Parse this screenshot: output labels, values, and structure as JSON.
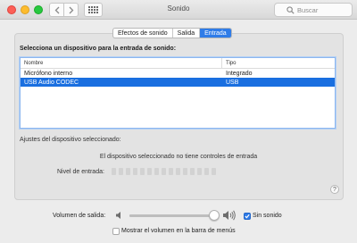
{
  "window": {
    "title": "Sonido",
    "search_placeholder": "Buscar"
  },
  "tabs": [
    {
      "label": "Efectos de sonido",
      "active": false
    },
    {
      "label": "Salida",
      "active": false
    },
    {
      "label": "Entrada",
      "active": true
    }
  ],
  "input": {
    "heading": "Selecciona un dispositivo para la entrada de sonido:",
    "columns": {
      "name": "Nombre",
      "type": "Tipo"
    },
    "devices": [
      {
        "name": "Micrófono interno",
        "type": "Integrado",
        "selected": false
      },
      {
        "name": "USB Audio CODEC",
        "type": "USB",
        "selected": true
      }
    ],
    "adjust_label": "Ajustes del dispositivo seleccionado:",
    "no_controls_text": "El dispositivo seleccionado no tiene controles de entrada",
    "level_label": "Nivel de entrada:",
    "level_segments": 15,
    "level_active": 0
  },
  "output_volume": {
    "label": "Volumen de salida:",
    "level_fraction": 0.95,
    "mute_label": "Sin sonido",
    "mute_checked": true,
    "show_in_menu_label": "Mostrar el volumen en la barra de menús",
    "show_in_menu_checked": false
  },
  "colors": {
    "accent": "#2f7ce8",
    "selection": "#1a6fe0"
  },
  "icons": {
    "back": "chevron-left-icon",
    "forward": "chevron-right-icon",
    "grid": "grid-icon",
    "search": "search-icon",
    "help": "help-icon",
    "speaker_low": "speaker-low-icon",
    "speaker_high": "speaker-high-icon"
  }
}
